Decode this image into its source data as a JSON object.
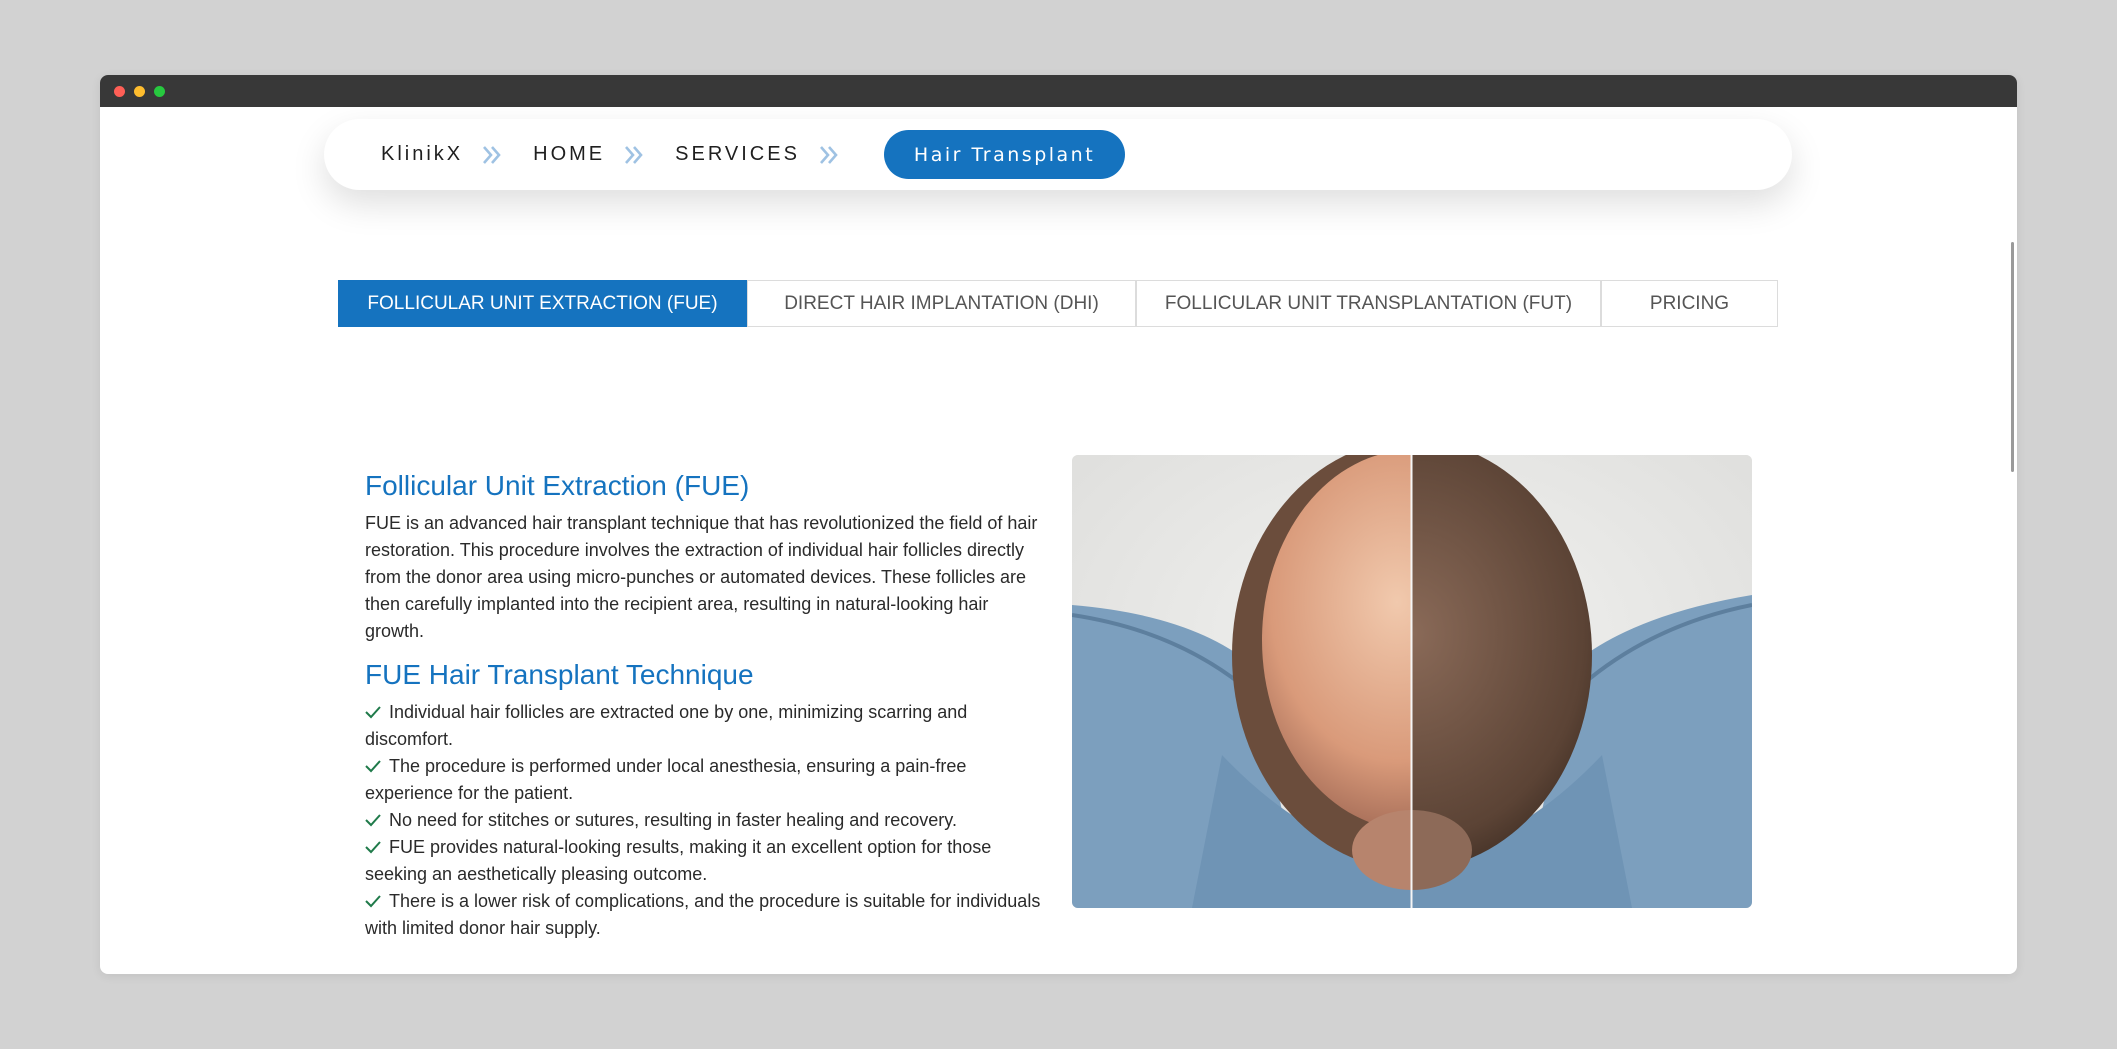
{
  "breadcrumb": {
    "items": [
      "KlinikX",
      "HOME",
      "SERVICES"
    ],
    "active": "Hair Transplant"
  },
  "tabs": [
    {
      "label": "FOLLICULAR UNIT EXTRACTION (FUE)",
      "active": true
    },
    {
      "label": "DIRECT HAIR IMPLANTATION (DHI)",
      "active": false
    },
    {
      "label": "FOLLICULAR UNIT TRANSPLANTATION (FUT)",
      "active": false
    },
    {
      "label": "PRICING",
      "active": false
    }
  ],
  "article": {
    "title": "Follicular Unit Extraction (FUE)",
    "intro": "FUE is an advanced hair transplant technique that has revolutionized the field of hair restoration. This procedure involves the extraction of individual hair follicles directly from the donor area using micro-punches or automated devices. These follicles are then carefully implanted into the recipient area, resulting in natural-looking hair growth.",
    "technique_title": "FUE Hair Transplant Technique",
    "bullets": [
      "Individual hair follicles are extracted one by one, minimizing scarring and discomfort.",
      "The procedure is performed under local anesthesia, ensuring a pain-free experience for the patient.",
      "No need for stitches or sutures, resulting in faster healing and recovery.",
      "FUE provides natural-looking results, making it an excellent option for those seeking an aesthetically pleasing outcome.",
      "There is a lower risk of complications, and the procedure is suitable for individuals with limited donor hair supply."
    ]
  },
  "colors": {
    "accent": "#1573bf",
    "breadcrumb_separator": "#9fc2e3",
    "check": "#1f7a4a"
  },
  "icons": {
    "separator": "double-chevron-right-icon",
    "bullet": "check-icon"
  }
}
